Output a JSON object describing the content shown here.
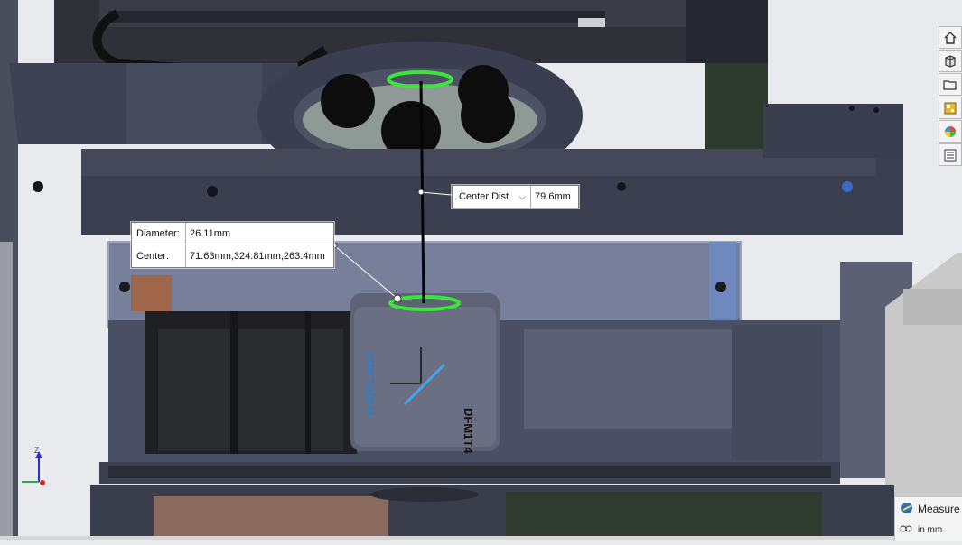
{
  "window": {
    "title": ""
  },
  "measurement": {
    "center_dist": {
      "label": "Center Dist",
      "dropdown_glyph": "⌵",
      "value": "79.6mm"
    },
    "circle": {
      "diameter_label": "Diameter:",
      "diameter_value": "26.11mm",
      "center_label": "Center:",
      "center_value": "71.63mm,324.81mm,263.4mm"
    }
  },
  "part_labels": {
    "brand": "THORLABS",
    "model": "DFM1T4"
  },
  "triad": {
    "z_label": "Z"
  },
  "toolbar": {
    "buttons": [
      {
        "name": "home-icon"
      },
      {
        "name": "parts-icon"
      },
      {
        "name": "file-explorer-icon"
      },
      {
        "name": "view-palette-icon"
      },
      {
        "name": "appearances-icon"
      },
      {
        "name": "custom-properties-icon"
      }
    ]
  },
  "measure_panel": {
    "title": "Measure",
    "units_label": "in mm",
    "icon": "measure-icon"
  },
  "colors": {
    "background": "#e9eaee",
    "assembly_dark": "#3d4050",
    "selection_green": "#39e639",
    "triad_blue": "#2d2dd8"
  }
}
